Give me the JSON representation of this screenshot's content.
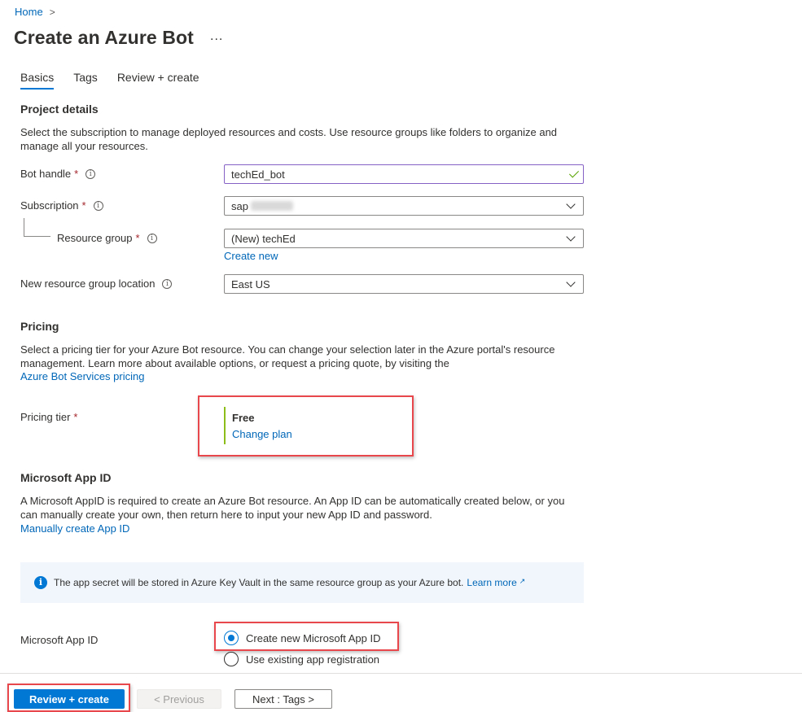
{
  "breadcrumb": {
    "home": "Home",
    "separator": ">"
  },
  "page": {
    "title": "Create an Azure Bot",
    "more": "..."
  },
  "tabs": [
    {
      "label": "Basics",
      "active": true
    },
    {
      "label": "Tags",
      "active": false
    },
    {
      "label": "Review + create",
      "active": false
    }
  ],
  "project": {
    "heading": "Project details",
    "description": "Select the subscription to manage deployed resources and costs. Use resource groups like folders to organize and manage all your resources.",
    "bot_handle": {
      "label": "Bot handle",
      "value": "techEd_bot"
    },
    "subscription": {
      "label": "Subscription",
      "value": "sap"
    },
    "resource_group": {
      "label": "Resource group",
      "value": "(New) techEd",
      "create_new": "Create new"
    },
    "location": {
      "label": "New resource group location",
      "value": "East US"
    },
    "required_mark": "*",
    "info_glyph": "i"
  },
  "pricing": {
    "heading": "Pricing",
    "description": "Select a pricing tier for your Azure Bot resource. You can change your selection later in the Azure portal's resource management. Learn more about available options, or request a pricing quote, by visiting the",
    "link": "Azure Bot Services pricing",
    "tier_label": "Pricing tier",
    "tier_value": "Free",
    "change_plan": "Change plan"
  },
  "app_id": {
    "heading": "Microsoft App ID",
    "description": "A Microsoft AppID is required to create an Azure Bot resource. An App ID can be automatically created below, or you can manually create your own, then return here to input your new App ID and password.",
    "manual_link": "Manually create App ID",
    "info_text": "The app secret will be stored in Azure Key Vault in the same resource group as your Azure bot.",
    "learn_more": "Learn more",
    "field_label": "Microsoft App ID",
    "options": [
      {
        "label": "Create new Microsoft App ID",
        "selected": true
      },
      {
        "label": "Use existing app registration",
        "selected": false
      }
    ]
  },
  "footer": {
    "review_create": "Review + create",
    "previous": "< Previous",
    "next": "Next : Tags >"
  },
  "colors": {
    "accent": "#0078d4",
    "highlight": "#e8474c",
    "tier_bar": "#8cbd18"
  }
}
